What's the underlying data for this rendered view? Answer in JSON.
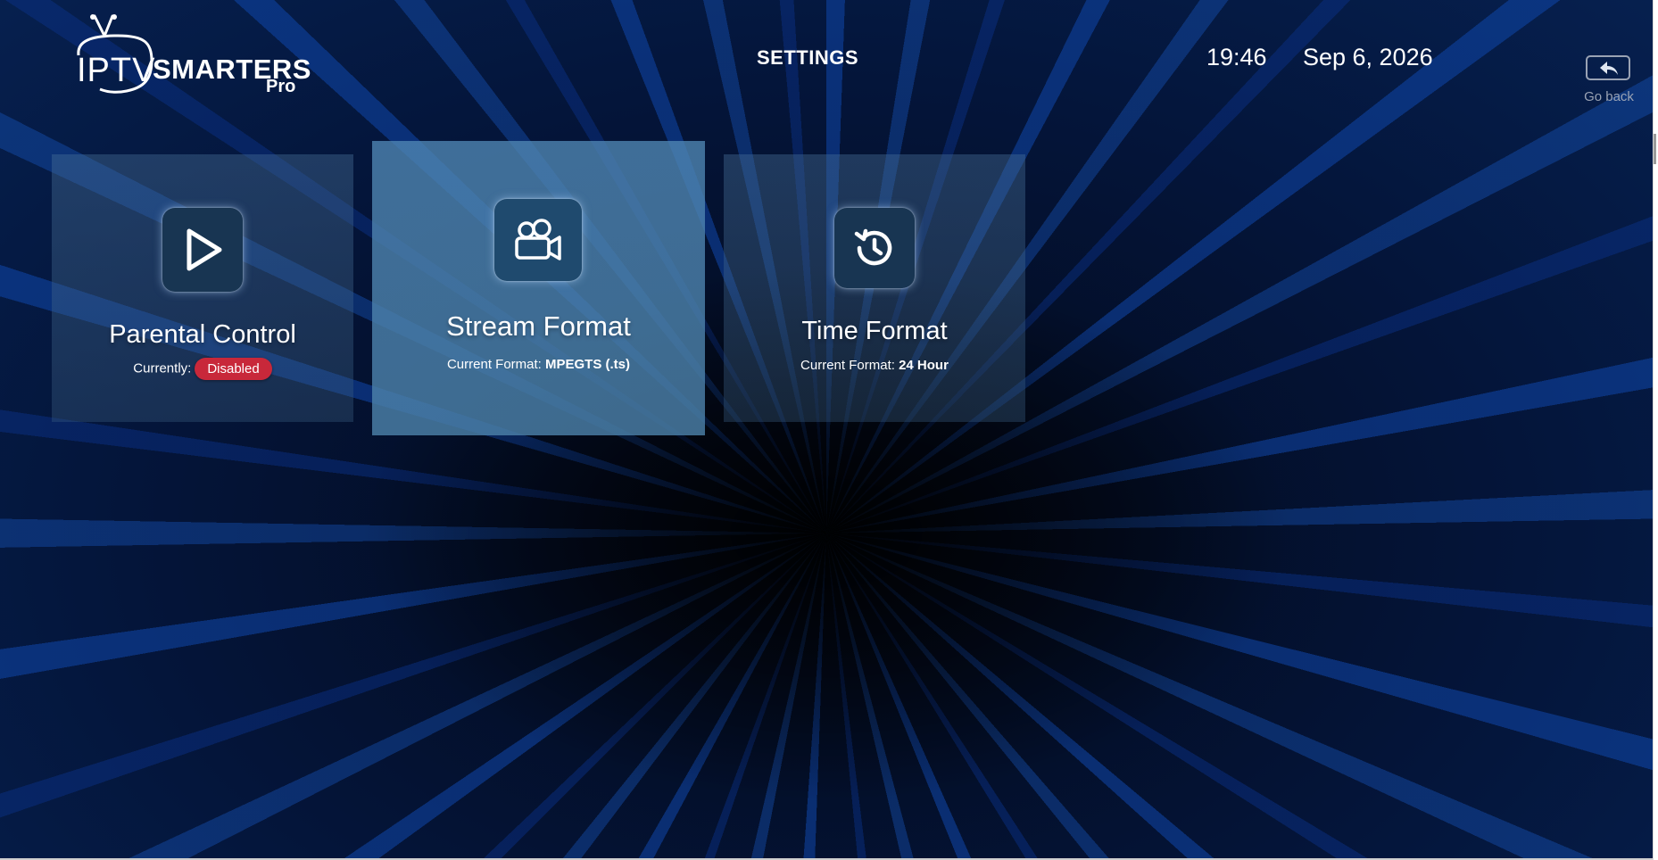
{
  "app": {
    "logo": {
      "iptv": "IPTV",
      "smarters": "SMARTERS",
      "pro": "Pro"
    },
    "title": "SETTINGS",
    "time": "19:46",
    "date": "Sep 6, 2026",
    "go_back_label": "Go back"
  },
  "cards": [
    {
      "title": "Parental Control",
      "sub_prefix": "Currently:",
      "sub_value": "Disabled",
      "icon": "play-icon"
    },
    {
      "title": "Stream Format",
      "sub_prefix": "Current Format:",
      "sub_value": "MPEGTS (.ts)",
      "icon": "video-camera-icon"
    },
    {
      "title": "Time Format",
      "sub_prefix": "Current Format:",
      "sub_value": "24 Hour",
      "icon": "history-clock-icon"
    }
  ],
  "colors": {
    "badge_disabled": "#c8283a",
    "selected_card": "#4f87b4",
    "accent_blue": "#0f46aa"
  }
}
